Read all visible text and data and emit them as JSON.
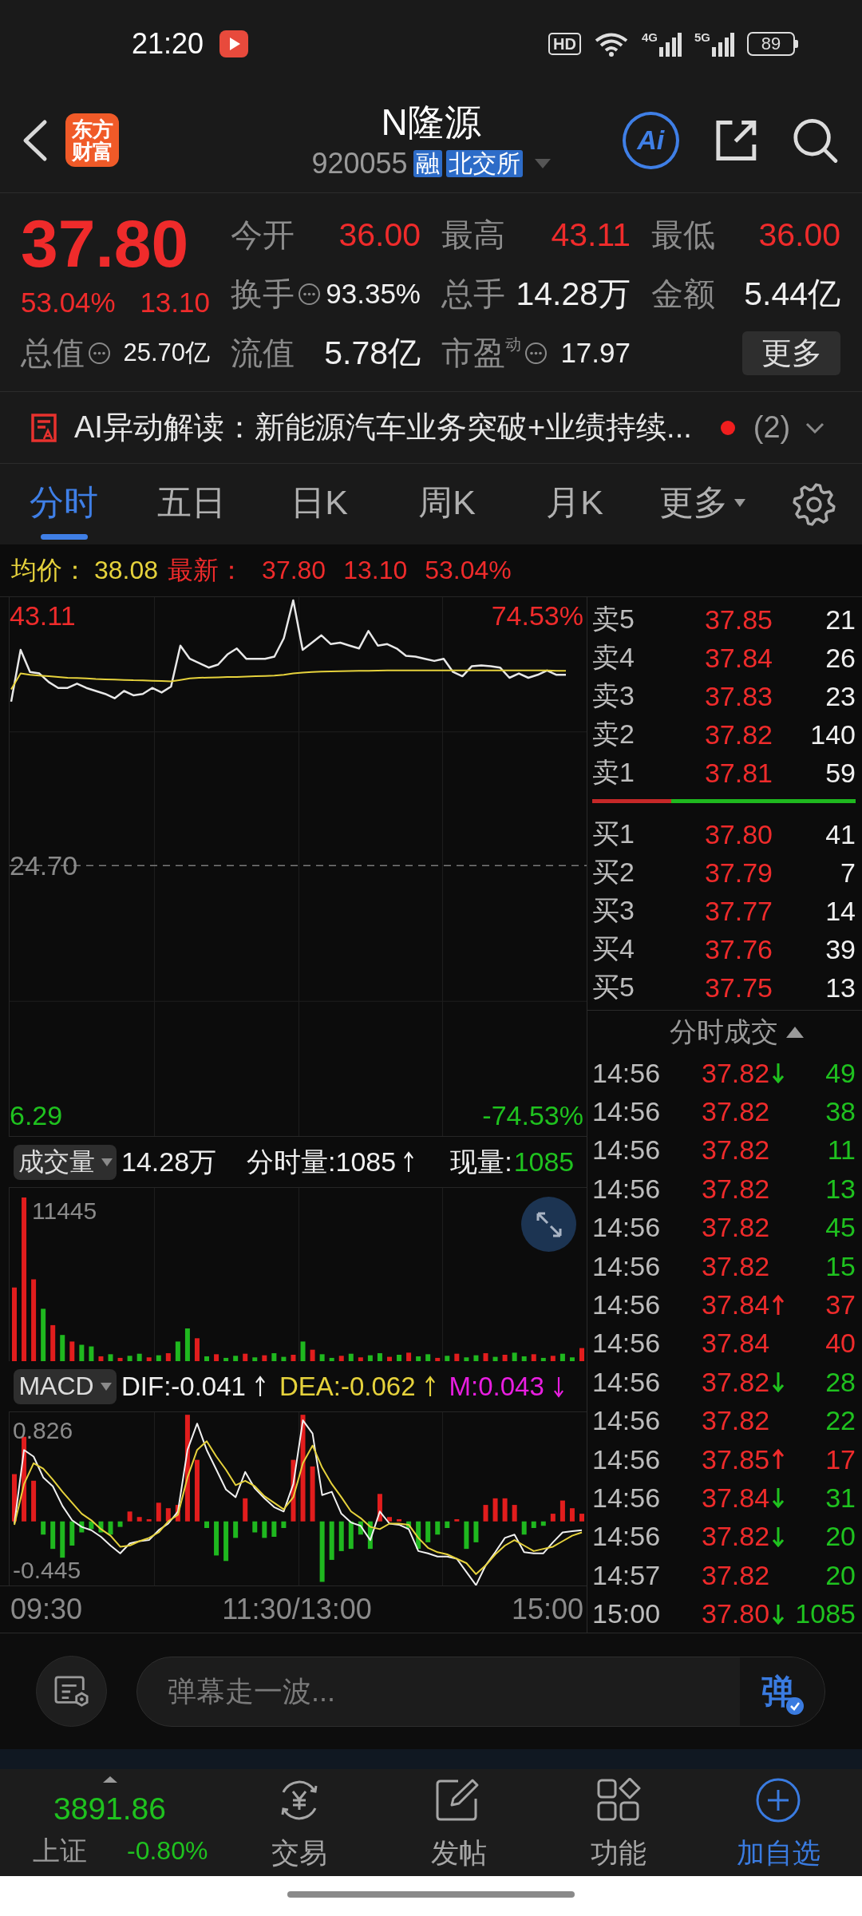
{
  "status_bar": {
    "time": "21:20",
    "hd_label": "HD",
    "networks": [
      {
        "label": "4G"
      },
      {
        "label": "5G"
      }
    ],
    "battery": "89"
  },
  "header": {
    "logo_lines": [
      "东方",
      "财富"
    ],
    "title": "N隆源",
    "code": "920055",
    "badges": [
      "融",
      "北交所"
    ],
    "ai_label": "Ai"
  },
  "quote": {
    "price": "37.80",
    "change_pct": "53.04%",
    "change": "13.10",
    "total_value": {
      "label": "总值",
      "value": "25.70亿",
      "info": true
    },
    "stats": [
      {
        "label": "今开",
        "value": "36.00",
        "rising": true,
        "info": false
      },
      {
        "label": "最高",
        "value": "43.11",
        "rising": true,
        "info": false
      },
      {
        "label": "最低",
        "value": "36.00",
        "rising": true,
        "info": false
      },
      {
        "label": "换手",
        "value": "93.35%",
        "rising": false,
        "info": true
      },
      {
        "label": "总手",
        "value": "14.28万",
        "rising": false,
        "info": false
      },
      {
        "label": "金额",
        "value": "5.44亿",
        "rising": false,
        "info": false
      },
      {
        "label": "流值",
        "value": "5.78亿",
        "rising": false,
        "info": false
      },
      {
        "label": "市盈$^{动}$",
        "value": "17.97",
        "rising": false,
        "info": true
      }
    ],
    "more_button": "更多"
  },
  "ai_insight": {
    "text": "AI异动解读：新能源汽车业务突破+业绩持续...",
    "unread": true,
    "count": "(2)"
  },
  "tabs": [
    {
      "label": "分时",
      "selected": true,
      "dropdown": false
    },
    {
      "label": "五日",
      "selected": false,
      "dropdown": false
    },
    {
      "label": "日K",
      "selected": false,
      "dropdown": false
    },
    {
      "label": "周K",
      "selected": false,
      "dropdown": false
    },
    {
      "label": "月K",
      "selected": false,
      "dropdown": false
    },
    {
      "label": "更多",
      "selected": false,
      "dropdown": true
    }
  ],
  "summary_line": {
    "avg_label": "均价：",
    "avg_value": "38.08",
    "latest_label": "最新：",
    "latest_values": [
      "37.80",
      "13.10",
      "53.04%"
    ]
  },
  "price_chart": {
    "pct_high": "74.53%",
    "pct_low": "-74.53%",
    "chart_data": {
      "type": "line",
      "categories": [
        null,
        null,
        null,
        null,
        null,
        null,
        null,
        null,
        null,
        null,
        null,
        null,
        null,
        null,
        null,
        null,
        null,
        null,
        null,
        null,
        null,
        null,
        null,
        null,
        null,
        null,
        null,
        null,
        null,
        null,
        null,
        null,
        null,
        null,
        null,
        null,
        null,
        null,
        null,
        null,
        null,
        null,
        null,
        null,
        null,
        null,
        null,
        null,
        null,
        null,
        null,
        null,
        null,
        null,
        null,
        null,
        null,
        null,
        null,
        null
      ],
      "ylim": [
        4.78,
        44.48
      ],
      "yticks": [
        {
          "value": 43.11,
          "label": "43.11"
        },
        {
          "value": 24.7,
          "label": "24.70"
        },
        {
          "value": 6.29,
          "label": "6.29"
        }
      ],
      "ref_lines": [
        {
          "axis": "y",
          "value": 24.7
        }
      ],
      "series": [
        {
          "color": "#e8e8e8",
          "values": [
            36.78,
            40.59,
            38.97,
            38.86,
            38.22,
            37.79,
            37.79,
            38.11,
            37.79,
            37.57,
            37.35,
            37.03,
            37.57,
            37.25,
            37.35,
            37.79,
            37.46,
            37.89,
            40.91,
            39.94,
            39.62,
            39.29,
            39.51,
            40.26,
            40.7,
            39.94,
            39.94,
            39.94,
            40.1,
            41.45,
            44.25,
            40.59,
            41.13,
            41.67,
            41.02,
            41.13,
            40.91,
            40.7,
            41.99,
            40.91,
            41.02,
            40.7,
            40.16,
            40.1,
            39.94,
            39.78,
            39.94,
            38.97,
            38.65,
            39.4,
            39.46,
            39.4,
            39.29,
            38.54,
            38.86,
            38.54,
            38.76,
            39.08,
            38.76,
            38.76
          ]
        },
        {
          "color": "#e6d23c",
          "values": [
            37.68,
            38.86,
            38.76,
            38.7,
            38.65,
            38.59,
            38.54,
            38.52,
            38.49,
            38.45,
            38.43,
            38.41,
            38.38,
            38.36,
            38.35,
            38.32,
            38.3,
            38.28,
            38.38,
            38.49,
            38.54,
            38.56,
            38.57,
            38.59,
            38.6,
            38.63,
            38.65,
            38.67,
            38.7,
            38.76,
            38.86,
            38.92,
            38.97,
            38.99,
            39.01,
            39.03,
            39.04,
            39.05,
            39.06,
            39.07,
            39.08,
            39.08,
            39.08,
            39.08,
            39.08,
            39.08,
            39.08,
            39.08,
            39.08,
            39.08,
            39.08,
            39.08,
            39.08,
            39.08,
            39.08,
            39.08,
            39.08,
            39.08,
            39.06,
            39.06
          ]
        }
      ]
    }
  },
  "volume_panel": {
    "selector": "成交量",
    "total": "14.28万",
    "tick_label": "分时量:1085",
    "tick_rising": true,
    "current_label": "现量:",
    "current_value": "1085",
    "current_rising": false,
    "max_label": "11445"
  },
  "macd_panel": {
    "selector": "MACD",
    "indicators": [
      {
        "label": "DIF:-0.041",
        "rising": true,
        "color": "#f0f0f0"
      },
      {
        "label": "DEA:-0.062",
        "rising": true,
        "color": "#e6d23c"
      },
      {
        "label": "M:0.043",
        "rising": false,
        "color": "#e81ee0"
      }
    ],
    "chart_data": {
      "type": "line",
      "categories": [
        null,
        null,
        null,
        null,
        null,
        null,
        null,
        null,
        null,
        null,
        null,
        null,
        null,
        null,
        null,
        null,
        null,
        null,
        null,
        null,
        null,
        null,
        null,
        null,
        null,
        null,
        null,
        null,
        null,
        null,
        null,
        null,
        null,
        null,
        null,
        null,
        null,
        null,
        null,
        null,
        null,
        null,
        null,
        null,
        null,
        null,
        null,
        null,
        null,
        null,
        null,
        null,
        null,
        null,
        null,
        null,
        null,
        null,
        null,
        null
      ],
      "ylim": [
        -0.583,
        0.993
      ],
      "yticks": [
        {
          "value": 0.826,
          "label": "0.826"
        },
        {
          "value": -0.445,
          "label": "-0.445"
        }
      ],
      "series": [
        {
          "type": "bar",
          "color": "#e21d1d",
          "values": [
            0.43,
            0.77,
            0.37,
            null,
            null,
            null,
            null,
            null,
            null,
            null,
            null,
            null,
            0.09,
            0.04,
            0.02,
            0.17,
            0.12,
            0.15,
            0.97,
            0.56,
            null,
            null,
            null,
            null,
            0.21,
            null,
            null,
            null,
            null,
            0.56,
            0.97,
            0.5,
            null,
            null,
            null,
            null,
            null,
            null,
            0.25,
            0.04,
            0.02,
            null,
            null,
            null,
            null,
            null,
            0.02,
            null,
            null,
            0.15,
            0.21,
            0.21,
            0.15,
            null,
            null,
            null,
            0.07,
            0.19,
            0.12,
            0.07
          ]
        },
        {
          "type": "bar",
          "color": "#1fb81f",
          "values": [
            null,
            null,
            null,
            -0.12,
            -0.25,
            -0.33,
            -0.22,
            -0.1,
            -0.07,
            -0.1,
            -0.12,
            -0.05,
            null,
            null,
            null,
            null,
            null,
            null,
            null,
            null,
            -0.06,
            -0.31,
            -0.36,
            -0.15,
            null,
            -0.1,
            -0.15,
            -0.14,
            -0.06,
            null,
            null,
            null,
            -0.55,
            -0.35,
            -0.27,
            -0.25,
            -0.12,
            -0.25,
            null,
            null,
            null,
            -0.06,
            -0.25,
            -0.19,
            -0.12,
            -0.06,
            null,
            -0.25,
            -0.19,
            null,
            null,
            null,
            null,
            -0.12,
            -0.06,
            -0.04,
            null,
            null,
            null,
            null
          ]
        },
        {
          "type": "line",
          "color": "#f0f0f0",
          "values": [
            -0.02,
            0.65,
            0.59,
            0.4,
            0.32,
            0.14,
            0.01,
            -0.05,
            -0.08,
            -0.14,
            -0.22,
            -0.29,
            -0.2,
            -0.18,
            -0.17,
            -0.08,
            -0.02,
            0.09,
            0.65,
            0.89,
            0.65,
            0.47,
            0.29,
            0.22,
            0.45,
            0.3,
            0.21,
            0.13,
            0.09,
            0.34,
            0.92,
            0.8,
            0.24,
            0.27,
            0.07,
            -0.01,
            -0.04,
            -0.17,
            0.09,
            -0.02,
            -0.03,
            -0.07,
            -0.27,
            -0.29,
            -0.32,
            -0.32,
            -0.34,
            -0.46,
            -0.58,
            -0.4,
            -0.28,
            -0.15,
            -0.12,
            -0.28,
            -0.29,
            -0.29,
            -0.19,
            -0.1,
            -0.09,
            -0.08
          ]
        },
        {
          "type": "line",
          "color": "#e6d23c",
          "values": [
            -0.03,
            0.34,
            0.53,
            0.48,
            0.38,
            0.27,
            0.17,
            0.07,
            0.01,
            -0.07,
            -0.13,
            -0.23,
            -0.22,
            -0.18,
            -0.15,
            -0.1,
            0.0,
            0.06,
            0.4,
            0.65,
            0.73,
            0.59,
            0.47,
            0.33,
            0.37,
            0.32,
            0.23,
            0.17,
            0.11,
            0.22,
            0.53,
            0.69,
            0.49,
            0.34,
            0.22,
            0.09,
            0.03,
            -0.05,
            -0.07,
            -0.02,
            -0.02,
            -0.03,
            -0.15,
            -0.24,
            -0.28,
            -0.3,
            -0.34,
            -0.38,
            -0.48,
            -0.4,
            -0.3,
            -0.22,
            -0.17,
            -0.22,
            -0.27,
            -0.25,
            -0.23,
            -0.18,
            -0.13,
            -0.1
          ]
        }
      ]
    }
  },
  "time_axis": [
    "09:30",
    "11:30/13:00",
    "15:00"
  ],
  "order_book": {
    "asks": [
      {
        "label": "卖5",
        "price": "37.85",
        "volume": "21"
      },
      {
        "label": "卖4",
        "price": "37.84",
        "volume": "26"
      },
      {
        "label": "卖3",
        "price": "37.83",
        "volume": "23"
      },
      {
        "label": "卖2",
        "price": "37.82",
        "volume": "140"
      },
      {
        "label": "卖1",
        "price": "37.81",
        "volume": "59"
      }
    ],
    "ratio_bar": {
      "level": 0.3
    },
    "bids": [
      {
        "label": "买1",
        "price": "37.80",
        "volume": "41"
      },
      {
        "label": "买2",
        "price": "37.79",
        "volume": "7"
      },
      {
        "label": "买3",
        "price": "37.77",
        "volume": "14"
      },
      {
        "label": "买4",
        "price": "37.76",
        "volume": "39"
      },
      {
        "label": "买5",
        "price": "37.75",
        "volume": "13"
      }
    ]
  },
  "trades": {
    "title": "分时成交",
    "rows": [
      {
        "time": "14:56",
        "price": "37.82",
        "up_tick": false,
        "down_tick": true,
        "buy": false,
        "volume": "49"
      },
      {
        "time": "14:56",
        "price": "37.82",
        "up_tick": false,
        "down_tick": false,
        "buy": false,
        "volume": "38"
      },
      {
        "time": "14:56",
        "price": "37.82",
        "up_tick": false,
        "down_tick": false,
        "buy": false,
        "volume": "11"
      },
      {
        "time": "14:56",
        "price": "37.82",
        "up_tick": false,
        "down_tick": false,
        "buy": false,
        "volume": "13"
      },
      {
        "time": "14:56",
        "price": "37.82",
        "up_tick": false,
        "down_tick": false,
        "buy": false,
        "volume": "45"
      },
      {
        "time": "14:56",
        "price": "37.82",
        "up_tick": false,
        "down_tick": false,
        "buy": false,
        "volume": "15"
      },
      {
        "time": "14:56",
        "price": "37.84",
        "up_tick": true,
        "down_tick": false,
        "buy": true,
        "volume": "37"
      },
      {
        "time": "14:56",
        "price": "37.84",
        "up_tick": false,
        "down_tick": false,
        "buy": true,
        "volume": "40"
      },
      {
        "time": "14:56",
        "price": "37.82",
        "up_tick": false,
        "down_tick": true,
        "buy": false,
        "volume": "28"
      },
      {
        "time": "14:56",
        "price": "37.82",
        "up_tick": false,
        "down_tick": false,
        "buy": false,
        "volume": "22"
      },
      {
        "time": "14:56",
        "price": "37.85",
        "up_tick": true,
        "down_tick": false,
        "buy": true,
        "volume": "17"
      },
      {
        "time": "14:56",
        "price": "37.84",
        "up_tick": false,
        "down_tick": true,
        "buy": false,
        "volume": "31"
      },
      {
        "time": "14:56",
        "price": "37.82",
        "up_tick": false,
        "down_tick": true,
        "buy": false,
        "volume": "20"
      },
      {
        "time": "14:57",
        "price": "37.82",
        "up_tick": false,
        "down_tick": false,
        "buy": false,
        "volume": "20"
      },
      {
        "time": "15:00",
        "price": "37.80",
        "up_tick": false,
        "down_tick": true,
        "buy": false,
        "volume": "1085"
      }
    ]
  },
  "comment_bar": {
    "placeholder": "弹幕走一波...",
    "send_label": "弹"
  },
  "bottom_nav": {
    "index": {
      "name": "上证",
      "value": "3891.86",
      "change": "-0.80%",
      "rising": false
    },
    "items": [
      {
        "label": "交易",
        "kind": "trade",
        "accent": false
      },
      {
        "label": "发帖",
        "kind": "post",
        "accent": false
      },
      {
        "label": "功能",
        "kind": "apps",
        "accent": false
      },
      {
        "label": "加自选",
        "kind": "add",
        "accent": true
      }
    ]
  }
}
